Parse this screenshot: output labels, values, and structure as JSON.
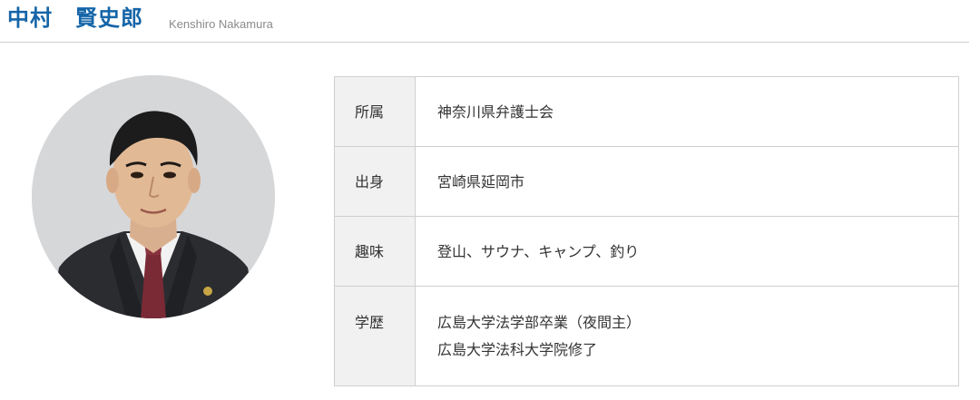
{
  "profile": {
    "name_ja": "中村　賢史郎",
    "name_en": "Kenshiro Nakamura",
    "photo_icon": "portrait-photo"
  },
  "details": {
    "rows": [
      {
        "label": "所属",
        "values": [
          "神奈川県弁護士会"
        ]
      },
      {
        "label": "出身",
        "values": [
          "宮崎県延岡市"
        ]
      },
      {
        "label": "趣味",
        "values": [
          "登山、サウナ、キャンプ、釣り"
        ]
      },
      {
        "label": "学歴",
        "values": [
          "広島大学法学部卒業（夜間主）",
          "広島大学法科大学院修了"
        ]
      }
    ]
  },
  "colors": {
    "name_accent": "#1565a8",
    "label_bg": "#f1f1f1",
    "border": "#cfcfcf"
  }
}
